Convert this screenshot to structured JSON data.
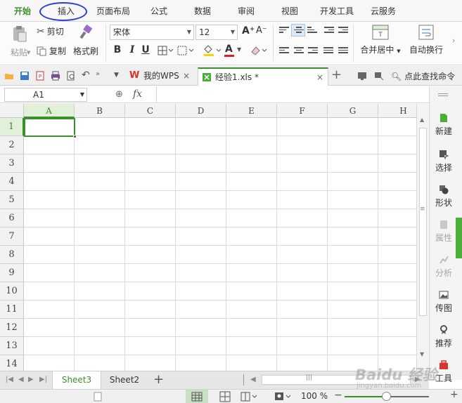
{
  "menu": {
    "tabs": [
      {
        "label": "开始",
        "active": true
      },
      {
        "label": "插入",
        "active": false,
        "annotated": true
      },
      {
        "label": "页面布局",
        "active": false
      },
      {
        "label": "公式",
        "active": false
      },
      {
        "label": "数据",
        "active": false
      },
      {
        "label": "审阅",
        "active": false
      },
      {
        "label": "视图",
        "active": false
      },
      {
        "label": "开发工具",
        "active": false
      },
      {
        "label": "云服务",
        "active": false
      }
    ]
  },
  "ribbon": {
    "paste_label": "粘贴",
    "cut_label": "剪切",
    "copy_label": "复制",
    "format_painter_label": "格式刷",
    "font_name": "宋体",
    "font_size": "12",
    "bold": "B",
    "italic": "I",
    "underline": "U",
    "font_color_letter": "A",
    "merge_center_label": "合并居中",
    "wrap_text_label": "自动换行",
    "grow_font": "A⁺",
    "shrink_font": "A⁻"
  },
  "doc_tabs": {
    "home_tab": "我的WPS",
    "active_tab": "经验1.xls *",
    "search_label": "点此查找命令"
  },
  "formula_bar": {
    "name_box": "A1",
    "fx_label": "fx",
    "value": ""
  },
  "grid": {
    "columns": [
      "A",
      "B",
      "C",
      "D",
      "E",
      "F",
      "G",
      "H"
    ],
    "rows": [
      "1",
      "2",
      "3",
      "4",
      "5",
      "6",
      "7",
      "8",
      "9",
      "10",
      "11",
      "12",
      "13",
      "14"
    ],
    "selected_cell": "A1"
  },
  "side_panel": {
    "items": [
      {
        "label": "新建",
        "icon": "new-icon",
        "enabled": true
      },
      {
        "label": "选择",
        "icon": "select-icon",
        "enabled": true
      },
      {
        "label": "形状",
        "icon": "shape-icon",
        "enabled": true
      },
      {
        "label": "属性",
        "icon": "properties-icon",
        "enabled": false
      },
      {
        "label": "分析",
        "icon": "analysis-icon",
        "enabled": false
      },
      {
        "label": "传图",
        "icon": "upload-image-icon",
        "enabled": true
      },
      {
        "label": "推荐",
        "icon": "recommend-icon",
        "enabled": true
      },
      {
        "label": "工具",
        "icon": "toolbox-icon",
        "enabled": true
      }
    ]
  },
  "sheets": {
    "tabs": [
      {
        "label": "Sheet3",
        "active": true
      },
      {
        "label": "Sheet2",
        "active": false
      }
    ],
    "add_label": "+"
  },
  "status": {
    "zoom": "100 %",
    "zoom_level": 0.5
  },
  "watermark": {
    "main": "Baidu 经验",
    "sub": "jingyan.baidu.com"
  },
  "colors": {
    "accent_green": "#3c8f2d",
    "annotation_blue": "#2b3cd6"
  }
}
